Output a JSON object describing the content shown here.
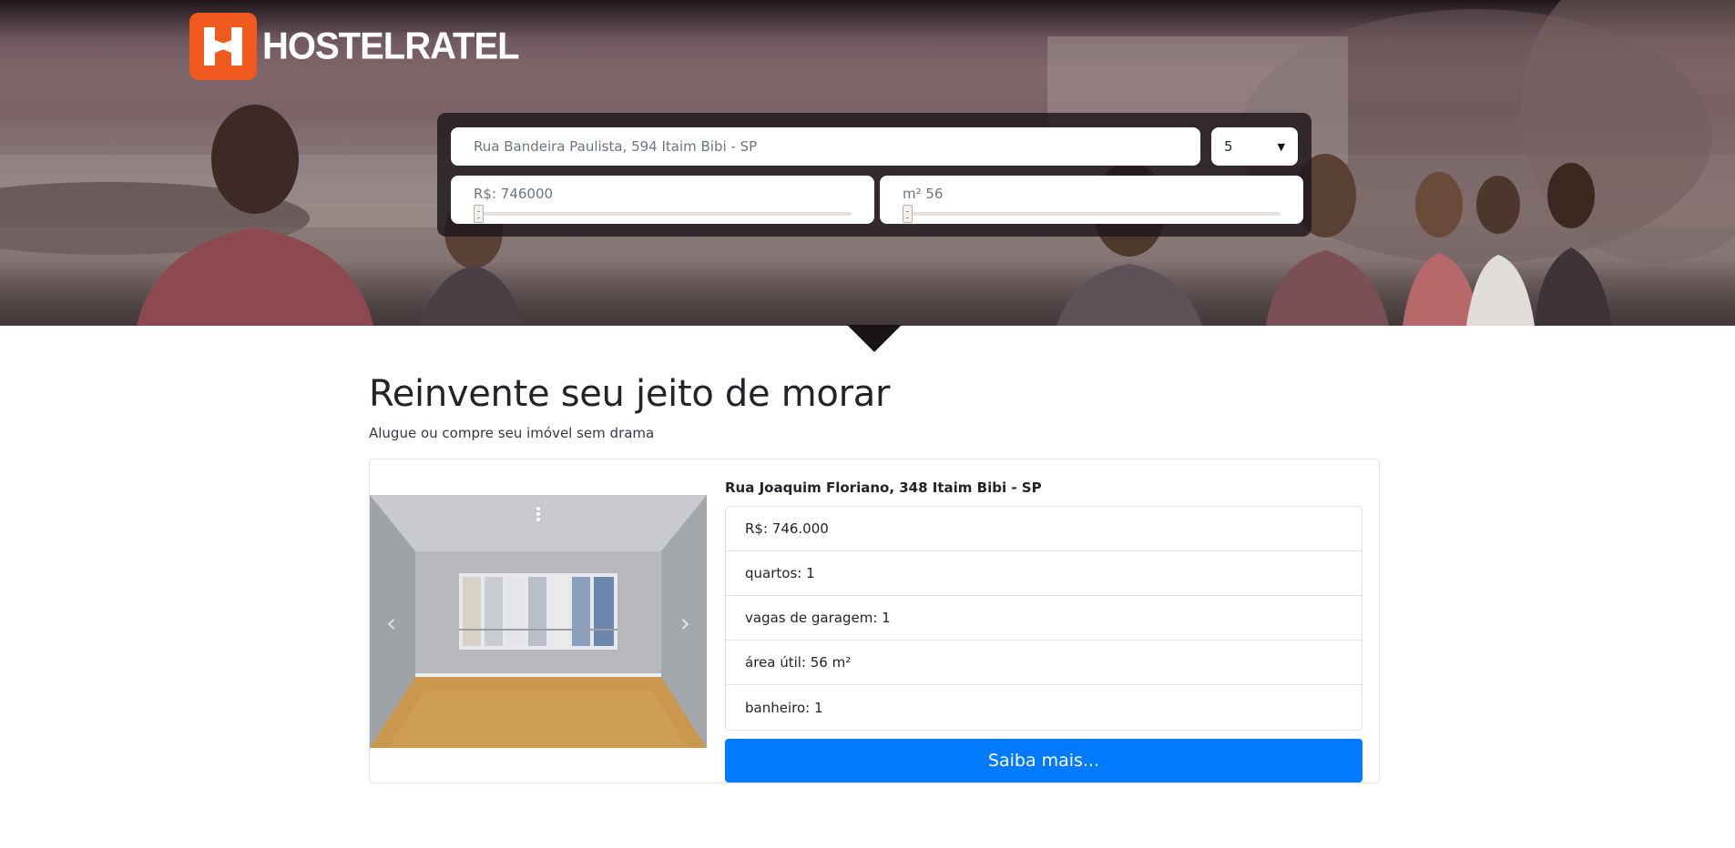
{
  "brand": {
    "name": "HOSTELRATEL",
    "color": "#f05a1e"
  },
  "search": {
    "address_placeholder": "Rua Bandeira Paulista, 594 Itaim Bibi - SP",
    "rooms_value": "5",
    "price_label": "R$: 746000",
    "area_label": "m² 56",
    "price_slider_fraction": 0.0,
    "area_slider_fraction": 0.0
  },
  "main": {
    "headline": "Reinvente seu jeito de morar",
    "subhead": "Alugue ou compre seu imóvel sem drama"
  },
  "listing": {
    "address": "Rua Joaquim Floriano, 348 Itaim Bibi - SP",
    "details": [
      "R$: 746.000",
      "quartos: 1",
      "vagas de garagem: 1",
      "área útil: 56 m²",
      "banheiro: 1"
    ],
    "button_label": "Saiba mais...",
    "button_color": "#007bff",
    "carousel_prev_icon": "chevron-left-icon",
    "carousel_next_icon": "chevron-right-icon"
  }
}
